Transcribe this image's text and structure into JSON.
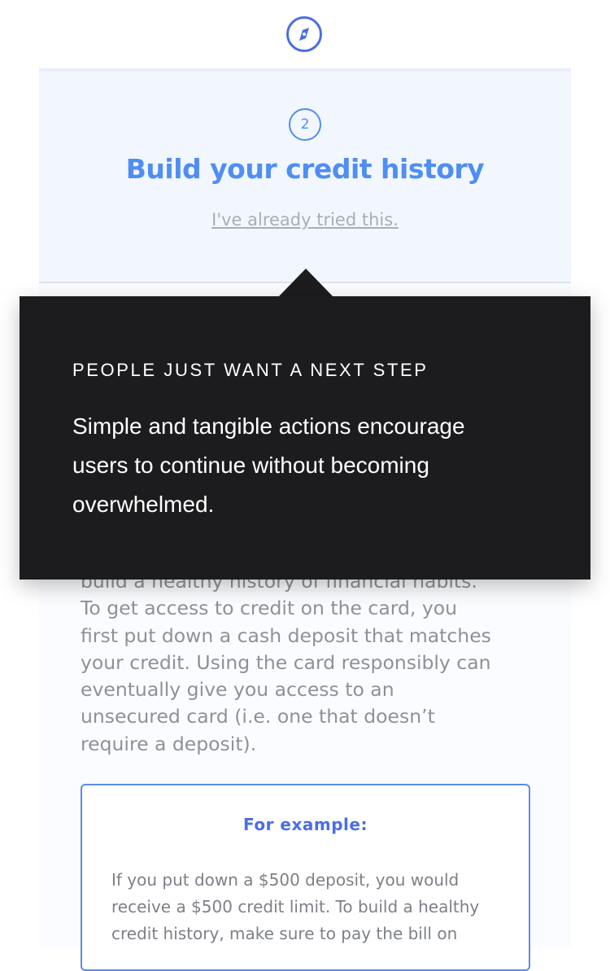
{
  "icons": {
    "top": "compass-icon"
  },
  "step": {
    "number": "2",
    "title": "Build your credit history",
    "already_tried_link": "I've already tried this."
  },
  "content": {
    "body_lines": [
      "build a healthy history of financial habits.",
      "To get access to credit on the card, you",
      "first put down a cash deposit that matches",
      "your credit. Using the card responsibly can",
      "eventually give you access to an",
      "unsecured card (i.e. one that doesn’t",
      "require a deposit)."
    ],
    "example": {
      "title": "For example:",
      "lines": [
        "If you put down a $500 deposit, you would",
        "receive a $500 credit limit. To build a healthy",
        "credit history, make sure to pay the bill on"
      ]
    }
  },
  "tooltip": {
    "heading": "PEOPLE JUST WANT A NEXT STEP",
    "body_lines": [
      "Simple and tangible actions encourage",
      "users to continue without becoming",
      "overwhelmed."
    ]
  },
  "colors": {
    "accent": "#4f8ef2",
    "tooltip_bg": "#1c1c1e",
    "body_text": "#8e9197"
  }
}
